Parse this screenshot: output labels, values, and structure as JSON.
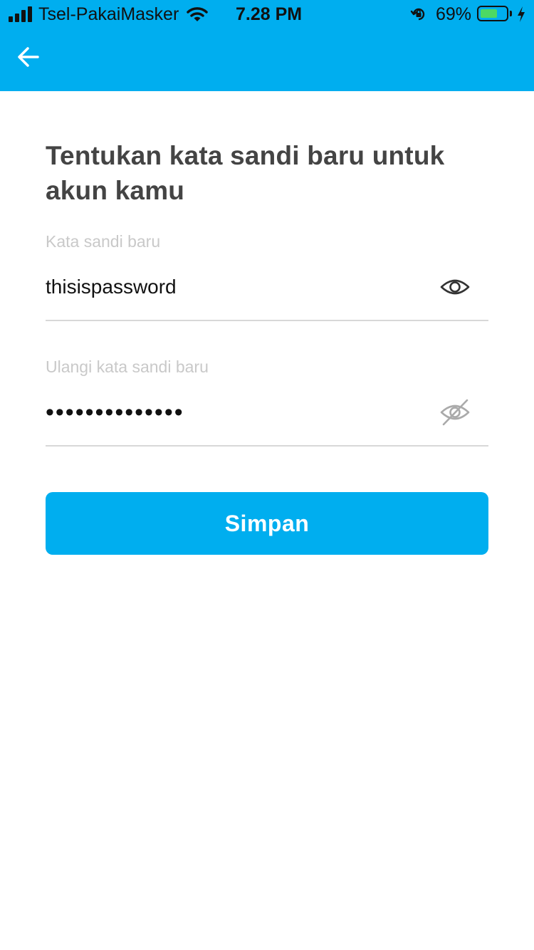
{
  "status_bar": {
    "carrier": "Tsel-PakaiMasker",
    "time": "7.28 PM",
    "battery_percent": "69%",
    "battery_level": 0.69,
    "icons": [
      "signal-icon",
      "wifi-icon",
      "orientation-lock-icon",
      "battery-icon",
      "charging-icon"
    ]
  },
  "header": {
    "back_icon": "arrow-left-icon",
    "color": "#00aeef"
  },
  "main": {
    "title": "Tentukan kata sandi baru untuk akun kamu",
    "new_password": {
      "label": "Kata sandi baru",
      "value": "thisispassword",
      "toggle_icon": "eye-icon"
    },
    "repeat_password": {
      "label": "Ulangi kata sandi baru",
      "masked_value": "••••••••••••••",
      "toggle_icon": "eye-off-icon"
    },
    "save_label": "Simpan"
  }
}
